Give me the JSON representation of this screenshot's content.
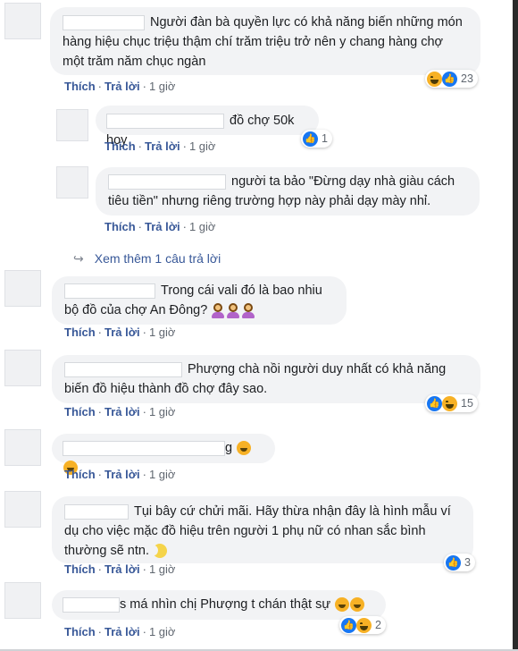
{
  "actions": {
    "like": "Thích",
    "reply": "Trả lời",
    "separator": "·"
  },
  "view_more": "Xem thêm 1 câu trả lời",
  "comments": [
    {
      "text": "Người đàn bà quyền lực có khả năng biến những món hàng hiệu chục triệu thậm chí trăm triệu trở nên y chang hàng chợ một trăm năm chục ngàn",
      "time": "1 giờ",
      "reactions": [
        "haha",
        "like"
      ],
      "reaction_count": "23"
    },
    {
      "text": "đồ chợ 50k hoy",
      "time": "1 giờ",
      "reactions": [
        "like"
      ],
      "reaction_count": "1"
    },
    {
      "text": "người ta bảo \"Đừng dạy nhà giàu cách tiêu tiền\" nhưng riêng trường hợp này phải dạy mày nhỉ.",
      "time": "1 giờ"
    },
    {
      "text": "Trong cái vali đó là bao nhiu bộ đồ của chợ An Đông?",
      "time": "1 giờ",
      "emojis": [
        "woman-shrugging",
        "woman-shrugging",
        "woman-shrugging"
      ]
    },
    {
      "text": "Phượng chà nồi người duy nhất có khả năng biến đồ hiệu thành đồ chợ đây sao.",
      "time": "1 giờ",
      "reactions": [
        "like",
        "haha"
      ],
      "reaction_count": "15"
    },
    {
      "text": "g",
      "time": "1 giờ",
      "emojis": [
        "laughing-face",
        "rolling-laughing-face"
      ]
    },
    {
      "text": "Tụi bây cứ chửi mãi. Hãy thừa nhận đây là hình mẫu ví dụ cho việc mặc đồ hiệu trên người 1 phụ nữ có nhan sắc bình thường sẽ ntn.",
      "time": "1 giờ",
      "emojis": [
        "moon-face"
      ],
      "reactions": [
        "like"
      ],
      "reaction_count": "3"
    },
    {
      "text": "s má nhìn chị Phượng t chán thật sự",
      "time": "1 giờ",
      "emojis": [
        "rolling-laughing-face",
        "rolling-laughing-face"
      ],
      "reactions": [
        "like",
        "haha"
      ],
      "reaction_count": "2"
    }
  ]
}
